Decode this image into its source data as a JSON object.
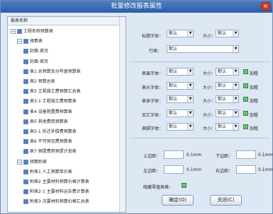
{
  "window": {
    "title": "批量修改报表属性",
    "close": "×"
  },
  "tree": {
    "header": "报表名称",
    "items": [
      {
        "label": "工程名称预算表",
        "level": 0,
        "expander": "−",
        "checked": true
      },
      {
        "label": "预算表",
        "level": 1,
        "expander": "−",
        "checked": true
      },
      {
        "label": "封面-首页",
        "level": 2,
        "checked": true
      },
      {
        "label": "封面-首页",
        "level": 2,
        "checked": true
      },
      {
        "label": "表1 总预算及分年度预算表",
        "level": 2,
        "checked": true
      },
      {
        "label": "表2 预算总表",
        "level": 2,
        "checked": true
      },
      {
        "label": "表3 工程施工费预算汇总表",
        "level": 2,
        "checked": true
      },
      {
        "label": "表3-1 工程施工费预算表",
        "level": 2,
        "checked": true
      },
      {
        "label": "表4 设备购置费预算表",
        "level": 2,
        "checked": true
      },
      {
        "label": "表5 其他费用预算表",
        "level": 2,
        "checked": true
      },
      {
        "label": "表5-1 拆迁补偿费预算表",
        "level": 2,
        "checked": true
      },
      {
        "label": "表6 不可预见费预算表",
        "level": 2,
        "checked": true
      },
      {
        "label": "表7 预提费用预提计划表",
        "level": 2,
        "checked": true
      },
      {
        "label": "预算附表",
        "level": 1,
        "expander": "−",
        "checked": true
      },
      {
        "label": "附表1 人工预算单价表",
        "level": 2,
        "checked": true
      },
      {
        "label": "附表2 主要材料预算价格计算表",
        "level": 2,
        "checked": true
      },
      {
        "label": "附表2-1 主要材料运杂费计算表",
        "level": 2,
        "checked": true
      },
      {
        "label": "附表3 次要材料预算价格汇总表",
        "level": 2,
        "checked": true
      }
    ]
  },
  "form": {
    "title_font_label": "标题字体：",
    "title_font_value": "默认",
    "size_label": "大小：",
    "size_value": "默认",
    "line_label": "行高：",
    "line_value": "默认",
    "rows": [
      {
        "label": "表眉字体：",
        "font": "默认",
        "size": "默认",
        "bold": "加粗"
      },
      {
        "label": "表头字体：",
        "font": "默认",
        "size": "默认",
        "bold": "加粗"
      },
      {
        "label": "表体字体：",
        "font": "默认",
        "size": "默认",
        "bold": "加粗"
      },
      {
        "label": "页汇字体：",
        "font": "默认",
        "size": "默认",
        "bold": "加粗"
      },
      {
        "label": "表脚字体：",
        "font": "默认",
        "size": "默认",
        "bold": "加粗"
      }
    ],
    "margin_top": "上边距：",
    "margin_bottom": "下边距：",
    "margin_left": "左边距：",
    "margin_right": "右边距：",
    "unit": "0.1mm",
    "hide_empty": "隐藏零值表格：",
    "ok": "确定(O)",
    "close": "关闭(C)"
  }
}
